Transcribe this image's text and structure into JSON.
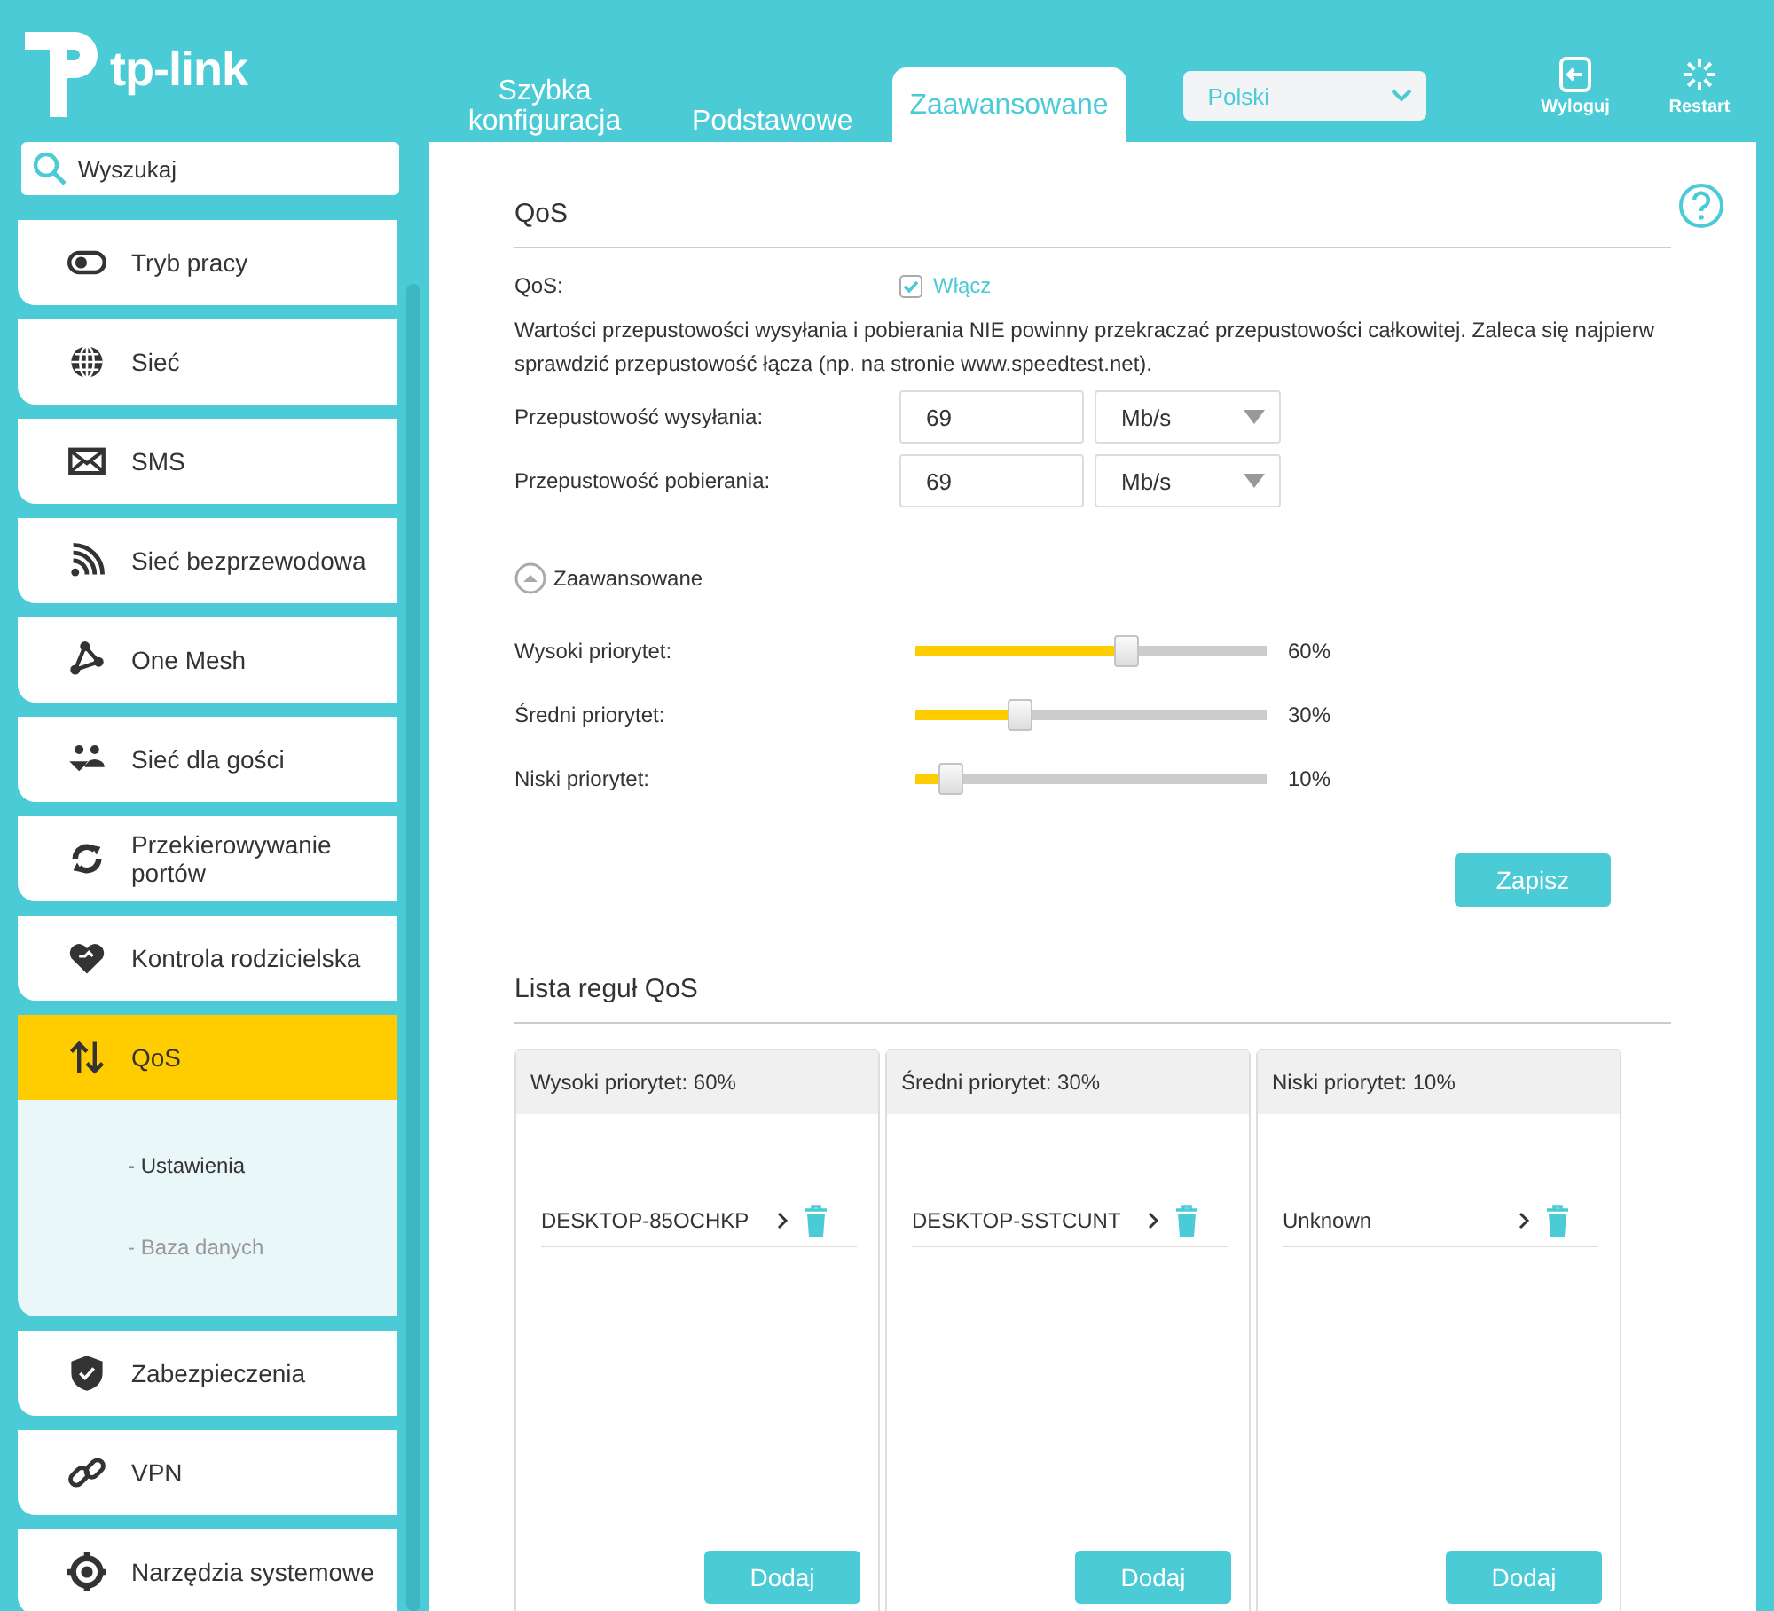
{
  "logo": {
    "text": "tp-link"
  },
  "tabs": [
    {
      "label": "Szybka konfiguracja",
      "selected": false
    },
    {
      "label": "Podstawowe",
      "selected": false
    },
    {
      "label": "Zaawansowane",
      "selected": true
    }
  ],
  "language": {
    "value": "Polski"
  },
  "header_actions": [
    {
      "kind": "logout",
      "label": "Wyloguj"
    },
    {
      "kind": "restart",
      "label": "Restart"
    }
  ],
  "search": {
    "placeholder": "Wyszukaj"
  },
  "sidebar": {
    "items": [
      {
        "label": "Tryb pracy",
        "selected": false
      },
      {
        "label": "Sieć",
        "selected": false
      },
      {
        "label": "SMS",
        "selected": false
      },
      {
        "label": "Sieć bezprzewodowa",
        "selected": false
      },
      {
        "label": "One Mesh",
        "selected": false
      },
      {
        "label": "Sieć dla gości",
        "selected": false
      },
      {
        "label": "Przekierowywanie portów",
        "selected": false
      },
      {
        "label": "Kontrola rodzicielska",
        "selected": false
      },
      {
        "label": "QoS",
        "selected": true,
        "children": [
          {
            "label": "- Ustawienia",
            "selected": true
          },
          {
            "label": "- Baza danych",
            "selected": false
          }
        ]
      },
      {
        "label": "Zabezpieczenia",
        "selected": false
      },
      {
        "label": "VPN",
        "selected": false
      },
      {
        "label": "Narzędzia systemowe",
        "selected": false
      }
    ]
  },
  "main": {
    "title": "QoS",
    "qos_toggle": {
      "label": "QoS:",
      "option": "Włącz",
      "checked": true
    },
    "note": "Wartości przepustowości wysyłania i pobierania NIE powinny przekraczać przepustowości całkowitej. Zaleca się najpierw sprawdzić przepustowość łącza (np. na stronie www.speedtest.net).",
    "bandwidth": [
      {
        "label": "Przepustowość wysyłania:",
        "value": "69",
        "unit": "Mb/s"
      },
      {
        "label": "Przepustowość pobierania:",
        "value": "69",
        "unit": "Mb/s"
      }
    ],
    "advanced": {
      "label": "Zaawansowane",
      "expanded": true
    },
    "priorities": [
      {
        "label": "Wysoki priorytet:",
        "level": 0.6,
        "reading": "60%"
      },
      {
        "label": "Średni priorytet:",
        "level": 0.3,
        "reading": "30%"
      },
      {
        "label": "Niski priorytet:",
        "level": 0.1,
        "reading": "10%"
      }
    ],
    "save_button": "Zapisz"
  },
  "rules": {
    "title": "Lista reguł QoS",
    "columns": [
      {
        "header": "Wysoki priorytet: 60%",
        "entries": [
          "DESKTOP-85OCHKP"
        ],
        "add_button": "Dodaj"
      },
      {
        "header": "Średni priorytet: 30%",
        "entries": [
          "DESKTOP-SSTCUNT"
        ],
        "add_button": "Dodaj"
      },
      {
        "header": "Niski priorytet: 10%",
        "entries": [
          "Unknown"
        ],
        "add_button": "Dodaj"
      }
    ]
  }
}
